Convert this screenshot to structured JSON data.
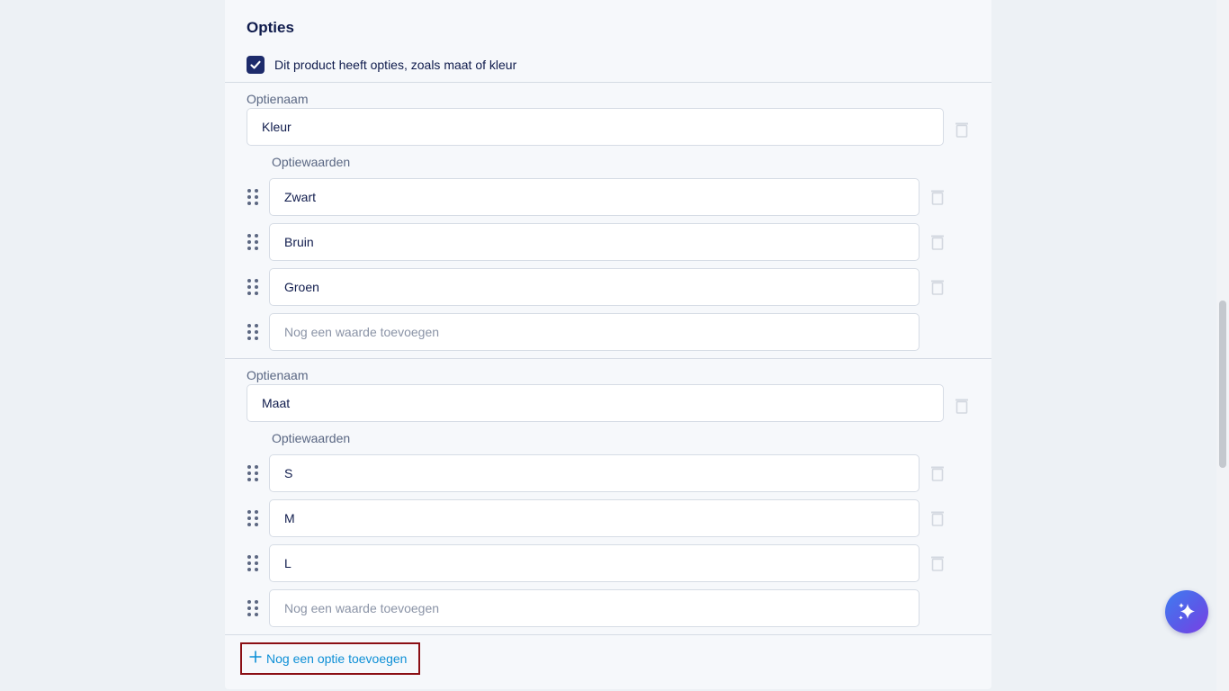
{
  "section": {
    "title": "Opties",
    "has_options_label": "Dit product heeft opties, zoals maat of kleur",
    "has_options_checked": true
  },
  "options": [
    {
      "name_label": "Optienaam",
      "name_value": "Kleur",
      "values_label": "Optiewaarden",
      "values": [
        "Zwart",
        "Bruin",
        "Groen"
      ],
      "new_value_placeholder": "Nog een waarde toevoegen"
    },
    {
      "name_label": "Optienaam",
      "name_value": "Maat",
      "values_label": "Optiewaarden",
      "values": [
        "S",
        "M",
        "L"
      ],
      "new_value_placeholder": "Nog een waarde toevoegen"
    }
  ],
  "add_option_label": "Nog een optie toevoegen",
  "icons": {
    "checkbox": "check-icon",
    "delete": "trash-icon",
    "drag": "drag-handle-icon",
    "add": "plus-icon",
    "assistant": "sparkle-icon"
  },
  "colors": {
    "accent_navy": "#1d2b6b",
    "link_blue": "#0d8fd6",
    "focus_outline": "#8b0e14",
    "assistant_gradient_start": "#3f7df0",
    "assistant_gradient_end": "#7b3fe4"
  }
}
